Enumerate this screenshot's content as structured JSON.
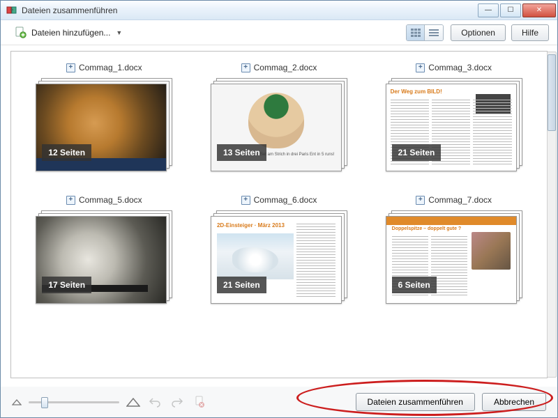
{
  "window": {
    "title": "Dateien zusammenführen"
  },
  "toolbar": {
    "add_files_label": "Dateien hinzufügen...",
    "options_label": "Optionen",
    "help_label": "Hilfe"
  },
  "files": [
    {
      "name": "Commag_1.docx",
      "page_count_label": "12 Seiten",
      "visual": "lion"
    },
    {
      "name": "Commag_2.docx",
      "page_count_label": "13 Seiten",
      "visual": "woman",
      "caption": "Set am Strich in drei Paris Ent in 5 runs!"
    },
    {
      "name": "Commag_3.docx",
      "page_count_label": "21 Seiten",
      "visual": "doc3",
      "heading": "Der Weg zum BILD!"
    },
    {
      "name": "Commag_5.docx",
      "page_count_label": "17 Seiten",
      "visual": "flower"
    },
    {
      "name": "Commag_6.docx",
      "page_count_label": "21 Seiten",
      "visual": "doc6",
      "heading": "2D-Einsteiger · März 2013"
    },
    {
      "name": "Commag_7.docx",
      "page_count_label": "6 Seiten",
      "visual": "doc7",
      "heading": "Doppelspitze – doppelt gute ?"
    }
  ],
  "footer": {
    "combine_label": "Dateien zusammenführen",
    "cancel_label": "Abbrechen"
  }
}
